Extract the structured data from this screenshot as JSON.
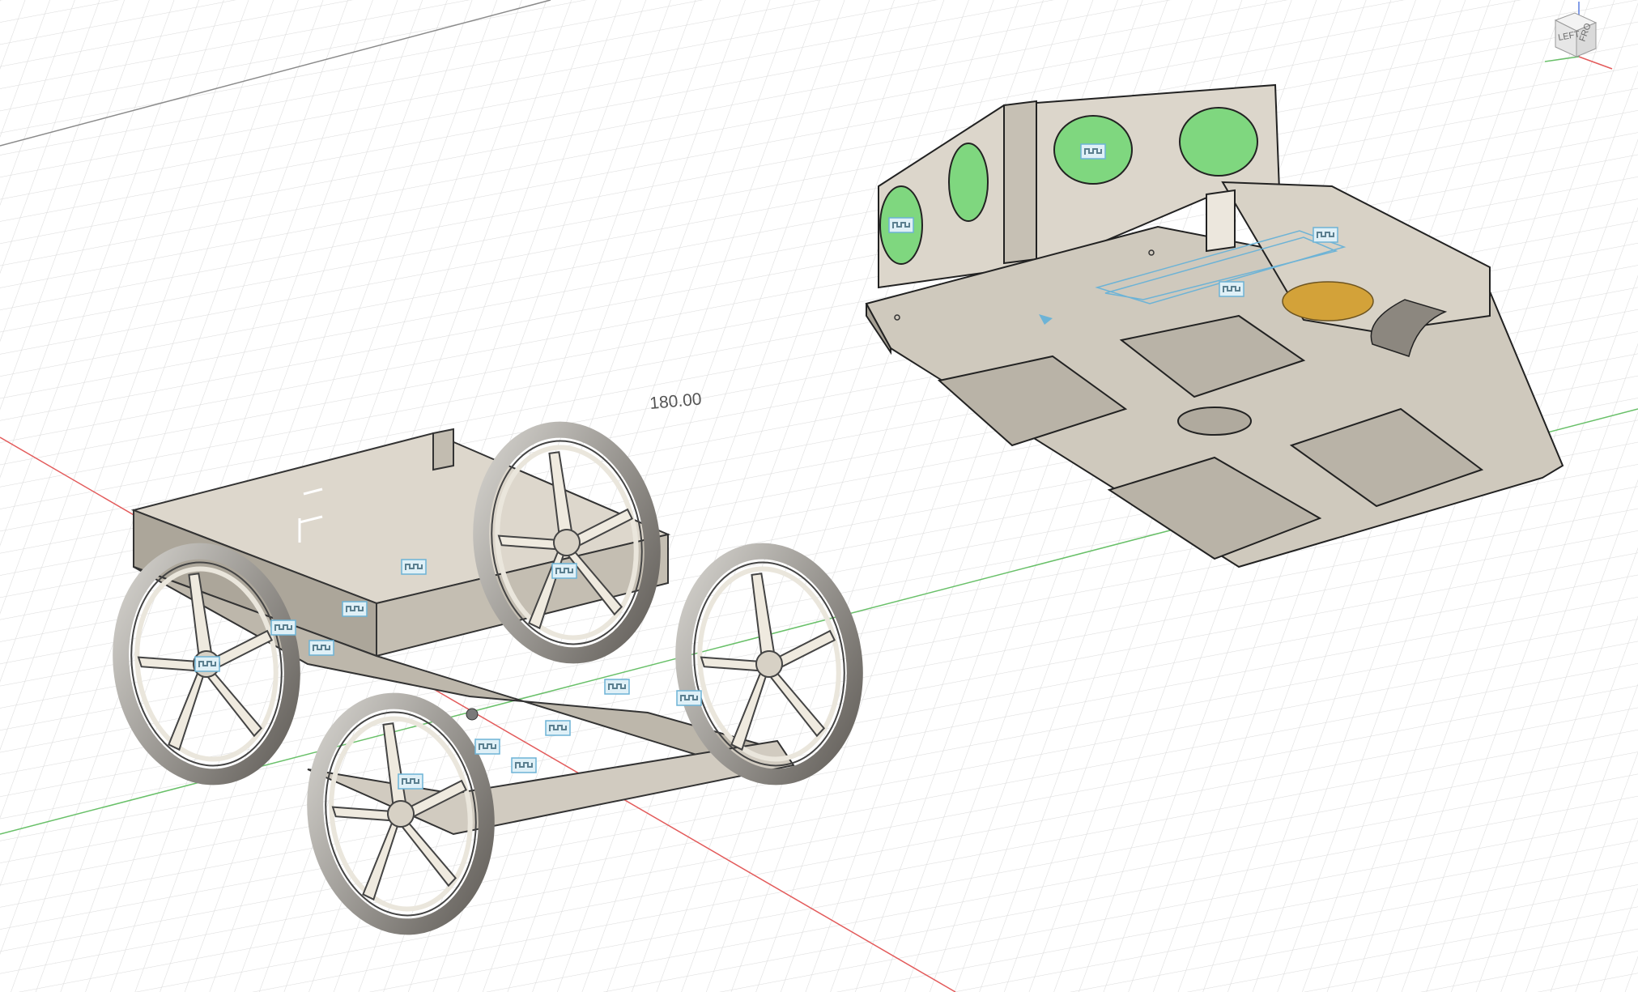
{
  "viewport": {
    "background": "#ffffff",
    "grid_color": "#dcdcdc",
    "x_axis_color": "#e35b5b",
    "y_axis_color": "#69c069",
    "model_body_color": "#cfc8bc",
    "model_shadow_color": "#8f8a82",
    "accent_fill": "#7fd77f",
    "bearing_color": "#d3a239",
    "selection_color": "#6db3d6"
  },
  "dimension": {
    "value": "180.00"
  },
  "viewcube": {
    "face_left": "LEFT",
    "face_front": "FRO",
    "icon": "viewcube-icon"
  },
  "joints": {
    "icon": "joint-icon",
    "count": 14
  }
}
